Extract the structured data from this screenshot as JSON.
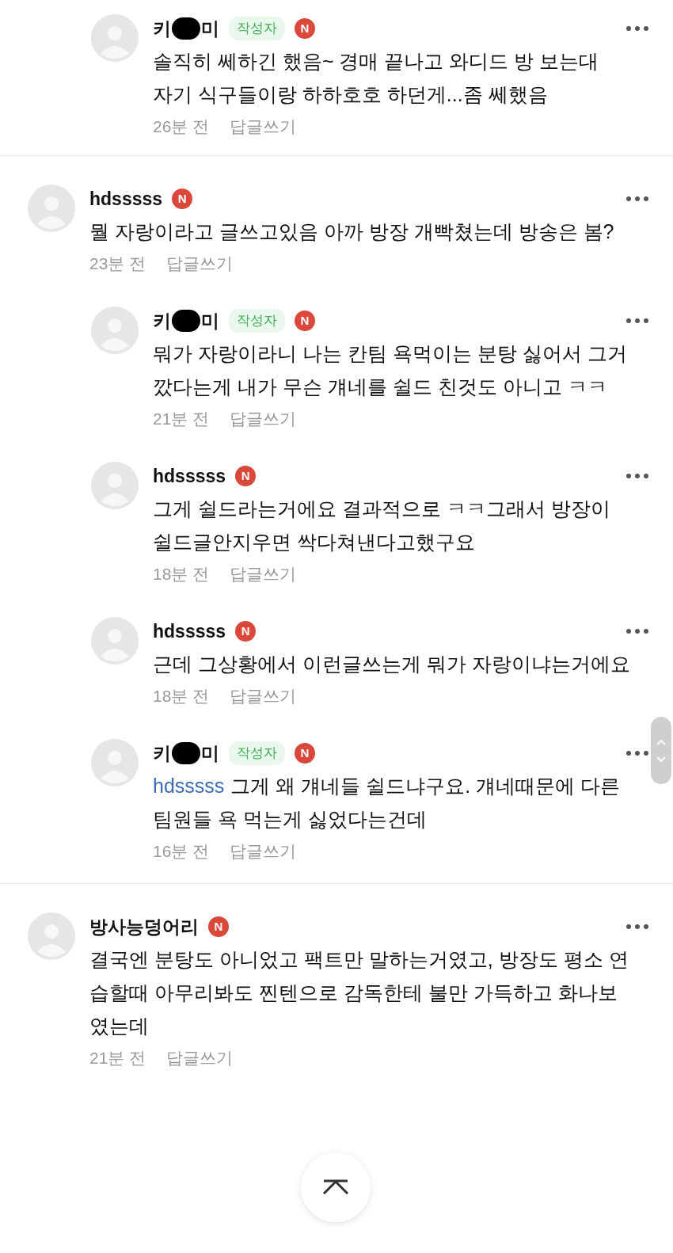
{
  "earlier_replies": [
    {
      "author": "키",
      "author_end": "미",
      "redacted": true,
      "author_tag": "작성자",
      "new_badge": "N",
      "text": "솔직히 쎄하긴 했음~ 경매 끝나고 와디드 방 보는대\n자기 식구들이랑 하하호호 하던게...좀 쎄했음",
      "time": "26분 전",
      "reply_label": "답글쓰기"
    }
  ],
  "comments": [
    {
      "author": "hdsssss",
      "new_badge": "N",
      "text": "뭘 자랑이라고 글쓰고있음 아까 방장 개빡쳤는데 방송은 봄?",
      "time": "23분 전",
      "reply_label": "답글쓰기",
      "children": [
        {
          "author": "키",
          "author_end": "미",
          "redacted": true,
          "author_tag": "작성자",
          "new_badge": "N",
          "text": "뭐가 자랑이라니 나는 칸팀 욕먹이는 분탕 싫어서 그거 깠다는게 내가 무슨 걔네를 쉴드 친것도 아니고 ㅋㅋ",
          "time": "21분 전",
          "reply_label": "답글쓰기"
        },
        {
          "author": "hdsssss",
          "new_badge": "N",
          "text": "그게 쉴드라는거에요 결과적으로 ㅋㅋ그래서 방장이 쉴드글안지우면 싹다쳐낸다고했구요",
          "time": "18분 전",
          "reply_label": "답글쓰기"
        },
        {
          "author": "hdsssss",
          "new_badge": "N",
          "text": "근데 그상황에서 이런글쓰는게 뭐가 자랑이냐는거에요",
          "time": "18분 전",
          "reply_label": "답글쓰기"
        },
        {
          "author": "키",
          "author_end": "미",
          "redacted": true,
          "author_tag": "작성자",
          "new_badge": "N",
          "mention": "hdsssss",
          "text": "그게 왜 걔네들 쉴드냐구요. 걔네때문에 다른 팀원들 욕 먹는게 싫었다는건데",
          "time": "16분 전",
          "reply_label": "답글쓰기"
        }
      ]
    },
    {
      "author": "방사능덩어리",
      "new_badge": "N",
      "text": "결국엔 분탕도 아니었고 팩트만 말하는거였고, 방장도 평소 연습할때 아무리봐도 찐텐으로 감독한테 불만 가득하고 화나보였는데",
      "time": "21분 전",
      "reply_label": "답글쓰기"
    }
  ]
}
